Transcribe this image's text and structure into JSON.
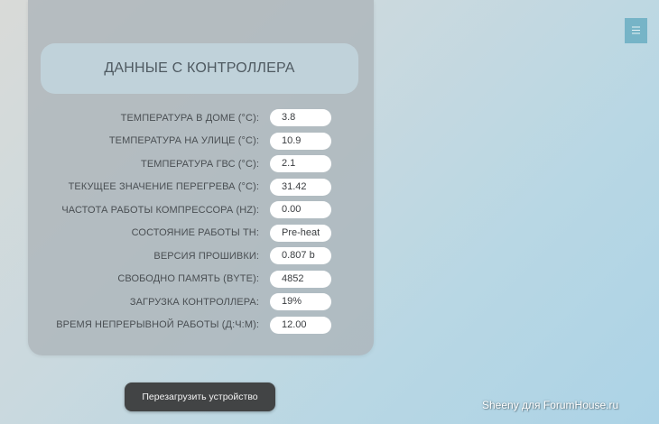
{
  "panel": {
    "title": "ДАННЫЕ С КОНТРОЛЛЕРА",
    "rows": [
      {
        "label": "ТЕМПЕРАТУРА В ДОМЕ (°C):",
        "value": "3.8"
      },
      {
        "label": "ТЕМПЕРАТУРА НА УЛИЦЕ (°C):",
        "value": "10.9"
      },
      {
        "label": "ТЕМПЕРАТУРА ГВС (°C):",
        "value": "2.1"
      },
      {
        "label": "ТЕКУЩЕЕ ЗНАЧЕНИЕ ПЕРЕГРЕВА (°C):",
        "value": "31.42"
      },
      {
        "label": "ЧАСТОТА РАБОТЫ КОМПРЕССОРА (HZ):",
        "value": "0.00"
      },
      {
        "label": "СОСТОЯНИЕ РАБОТЫ ТН:",
        "value": "Pre-heat"
      },
      {
        "label": "ВЕРСИЯ ПРОШИВКИ:",
        "value": "0.807 b"
      },
      {
        "label": "СВОБОДНО ПАМЯТЬ (BYTE):",
        "value": "4852"
      },
      {
        "label": "ЗАГРУЗКА КОНТРОЛЛЕРА:",
        "value": "19%"
      },
      {
        "label": "ВРЕМЯ НЕПРЕРЫВНОЙ РАБОТЫ (Д:Ч:М):",
        "value": "12.00"
      }
    ]
  },
  "actions": {
    "reboot_label": "Перезагрузить устройство"
  },
  "header": {
    "menu_icon": "hamburger-menu-icon"
  },
  "watermark": "Sheeny для ForumHouse.ru",
  "colors": {
    "panel": "#acb4b8",
    "panel_header": "#c0d2da",
    "button": "#424445",
    "menu_button": "#76b4c7"
  }
}
